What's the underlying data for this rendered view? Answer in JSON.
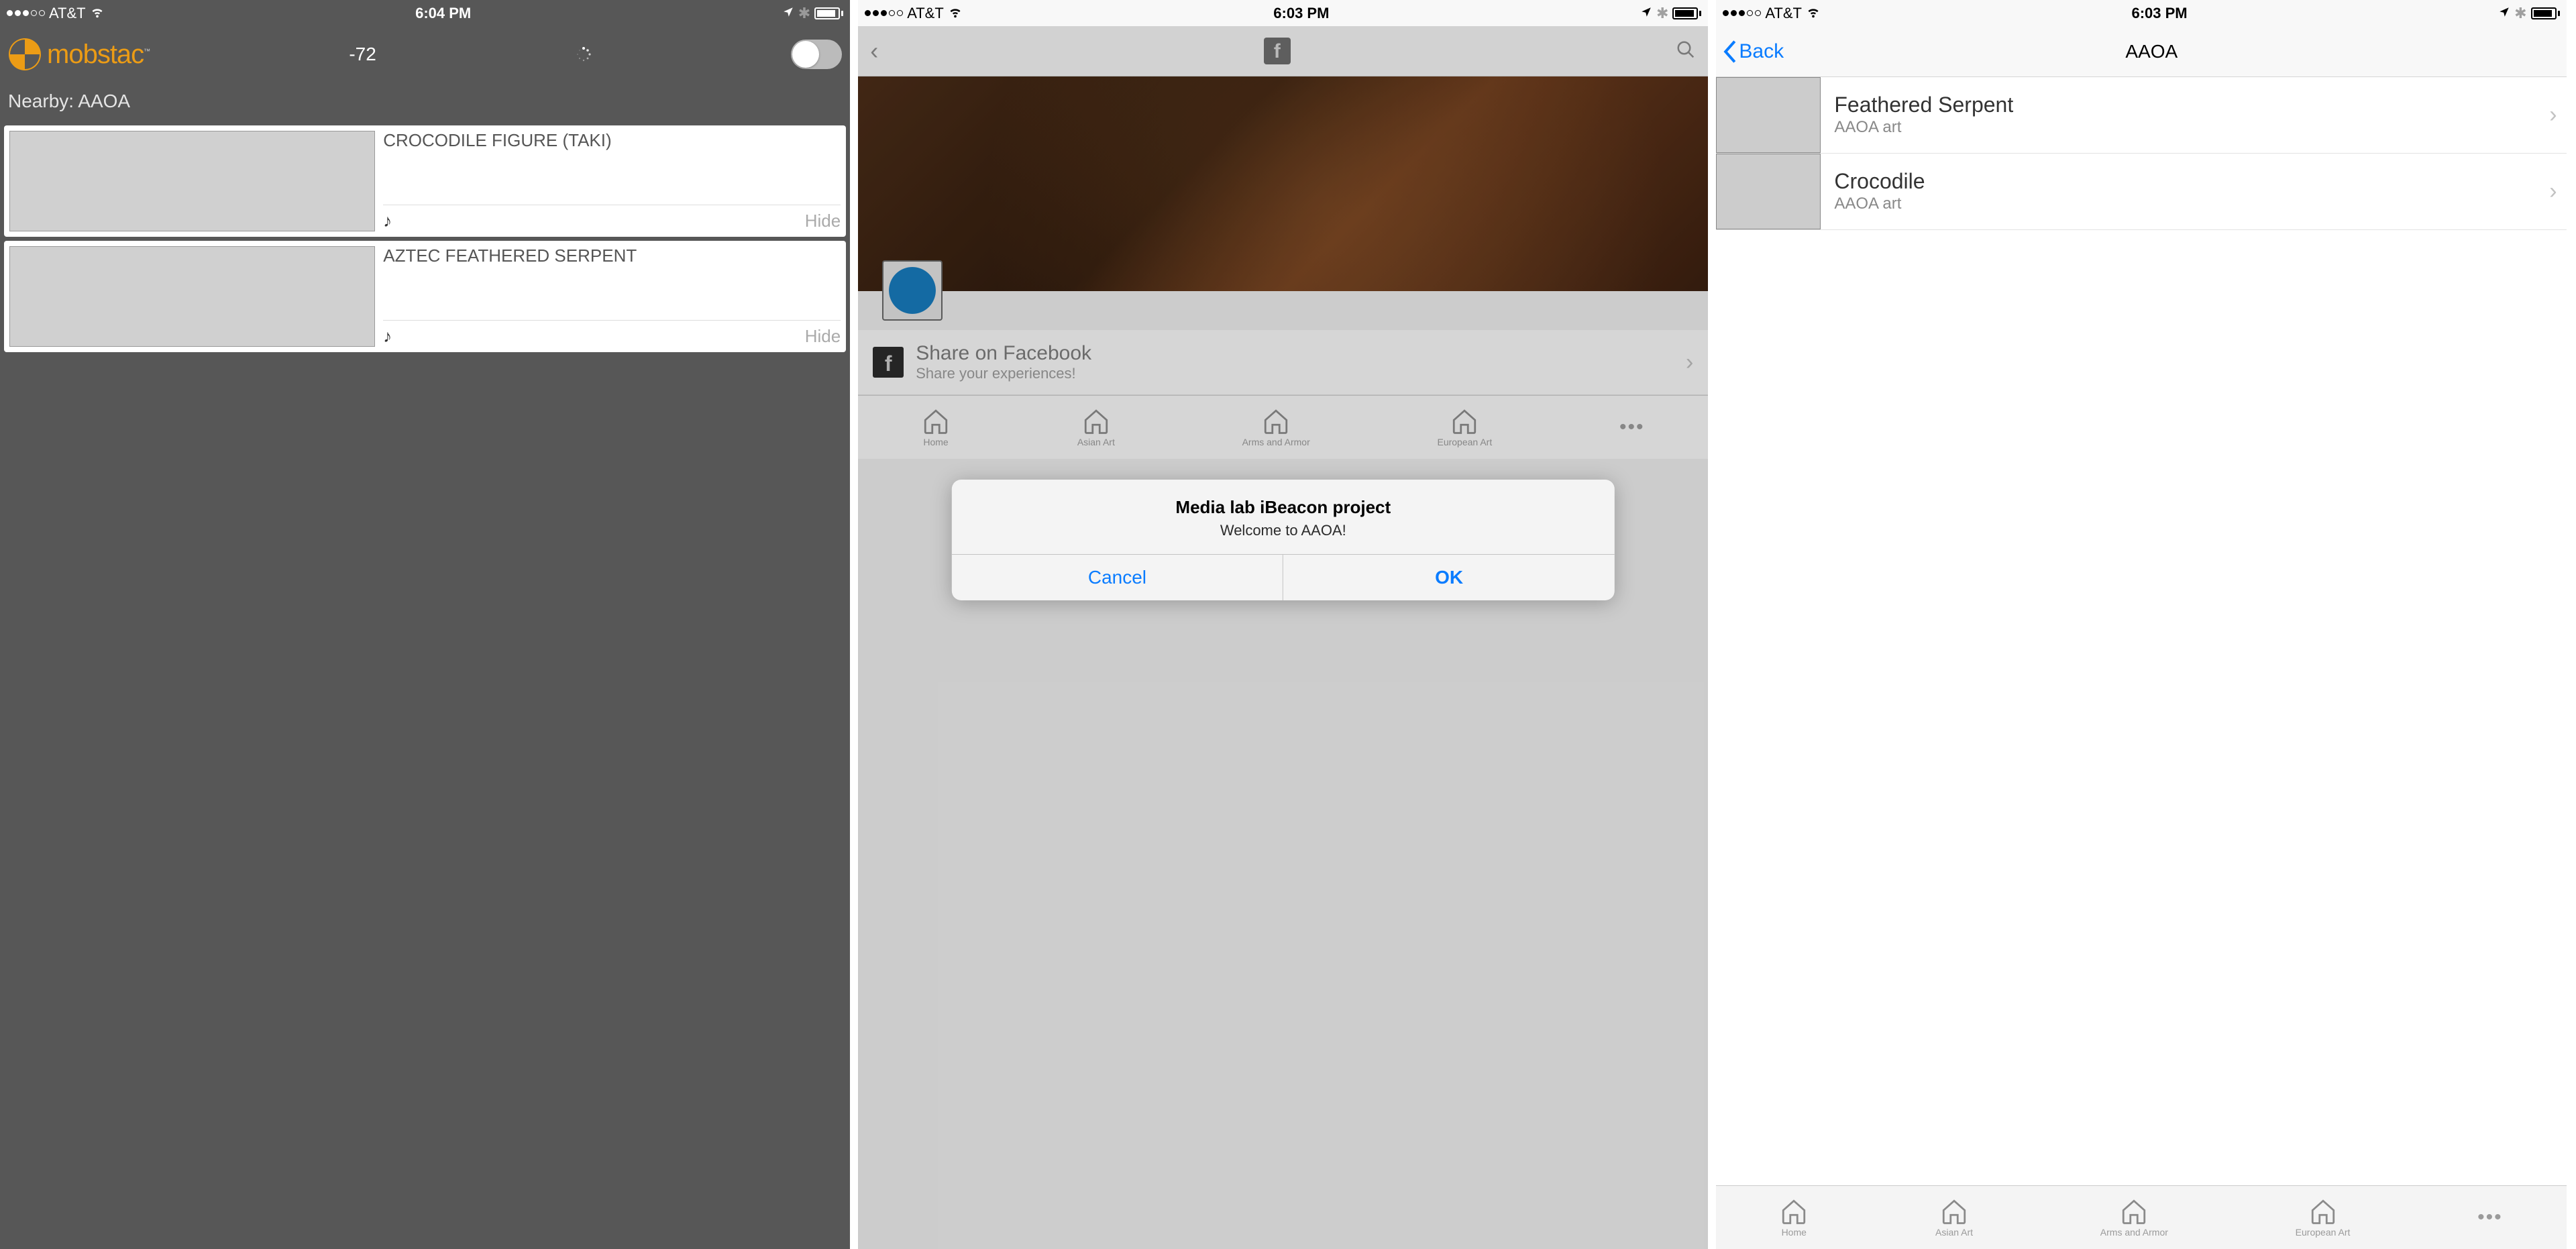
{
  "screen1": {
    "status": {
      "carrier": "AT&T",
      "time": "6:04 PM"
    },
    "header": {
      "logo_prefix": "mob",
      "logo_suffix": "stac",
      "rssi": "-72"
    },
    "nearby_label": "Nearby: AAOA",
    "cards": [
      {
        "title": "CROCODILE FIGURE (TAKI)",
        "hide": "Hide"
      },
      {
        "title": "AZTEC FEATHERED SERPENT",
        "hide": "Hide"
      }
    ]
  },
  "screen2": {
    "status": {
      "carrier": "AT&T",
      "time": "6:03 PM"
    },
    "alert": {
      "title": "Media lab iBeacon project",
      "message": "Welcome to AAOA!",
      "cancel": "Cancel",
      "ok": "OK"
    },
    "share": {
      "title": "Share on Facebook",
      "subtitle": "Share your experiences!"
    },
    "tabs": [
      "Home",
      "Asian Art",
      "Arms and Armor",
      "European Art"
    ]
  },
  "screen3": {
    "status": {
      "carrier": "AT&T",
      "time": "6:03 PM"
    },
    "nav": {
      "back": "Back",
      "title": "AAOA"
    },
    "rows": [
      {
        "title": "Feathered Serpent",
        "subtitle": "AAOA art"
      },
      {
        "title": "Crocodile",
        "subtitle": "AAOA art"
      }
    ],
    "tabs": [
      "Home",
      "Asian Art",
      "Arms and Armor",
      "European Art"
    ]
  }
}
